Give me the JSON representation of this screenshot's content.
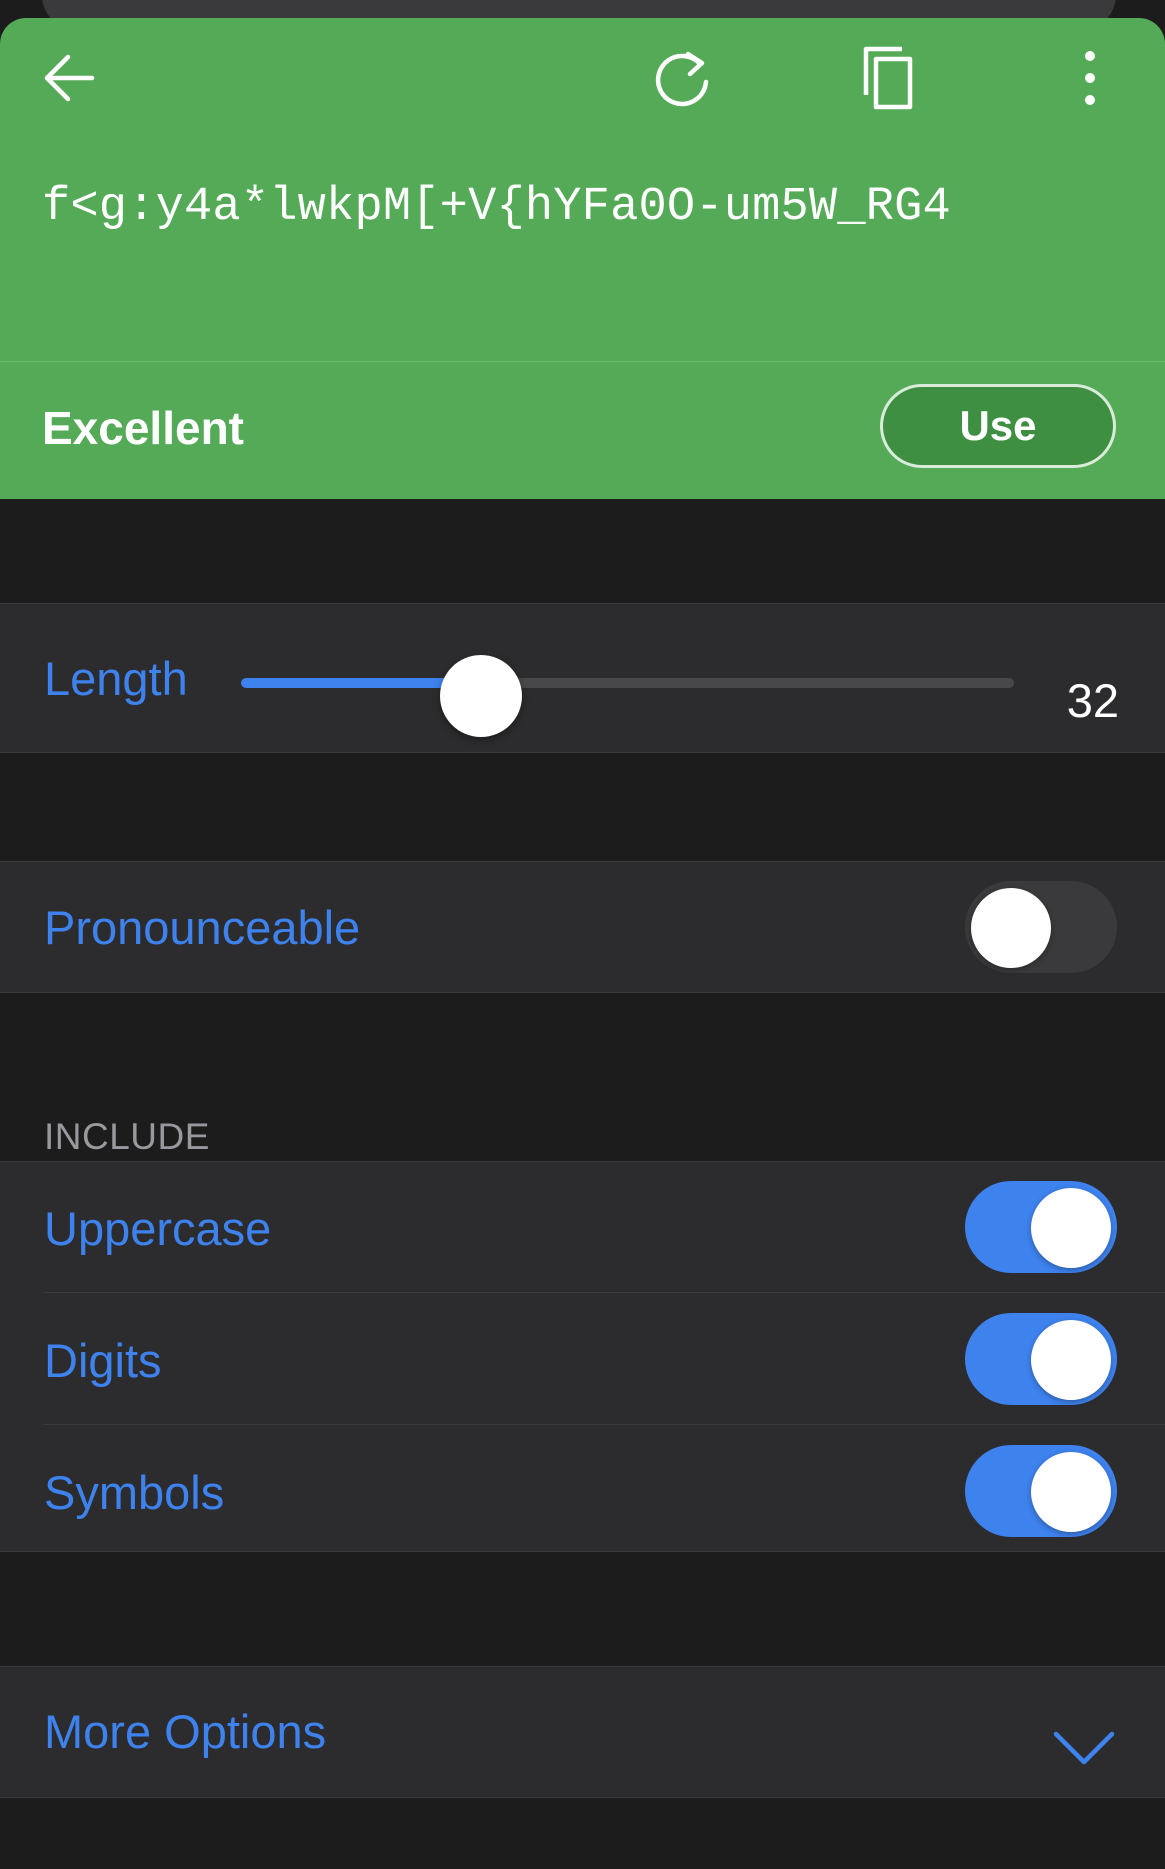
{
  "header": {
    "password": "f<g:y4a*lwkpM[+V{hYFa0O-um5W_RG4",
    "strength": "Excellent",
    "use_label": "Use"
  },
  "length": {
    "label": "Length",
    "value": "32",
    "slider_fraction": 0.31
  },
  "pronounceable": {
    "label": "Pronounceable",
    "on": false
  },
  "include": {
    "header": "INCLUDE",
    "items": [
      {
        "label": "Uppercase",
        "on": true
      },
      {
        "label": "Digits",
        "on": true
      },
      {
        "label": "Symbols",
        "on": true
      }
    ]
  },
  "more_options": {
    "label": "More Options"
  },
  "icons": {
    "back": "arrow-left-icon",
    "refresh": "refresh-icon",
    "copy": "copy-icon",
    "more": "more-vertical-icon",
    "chevron": "chevron-down-icon"
  },
  "colors": {
    "header_green": "#54aa57",
    "accent_blue": "#3e82ee",
    "background": "#1c1c1d",
    "cell": "#2c2c2e"
  }
}
